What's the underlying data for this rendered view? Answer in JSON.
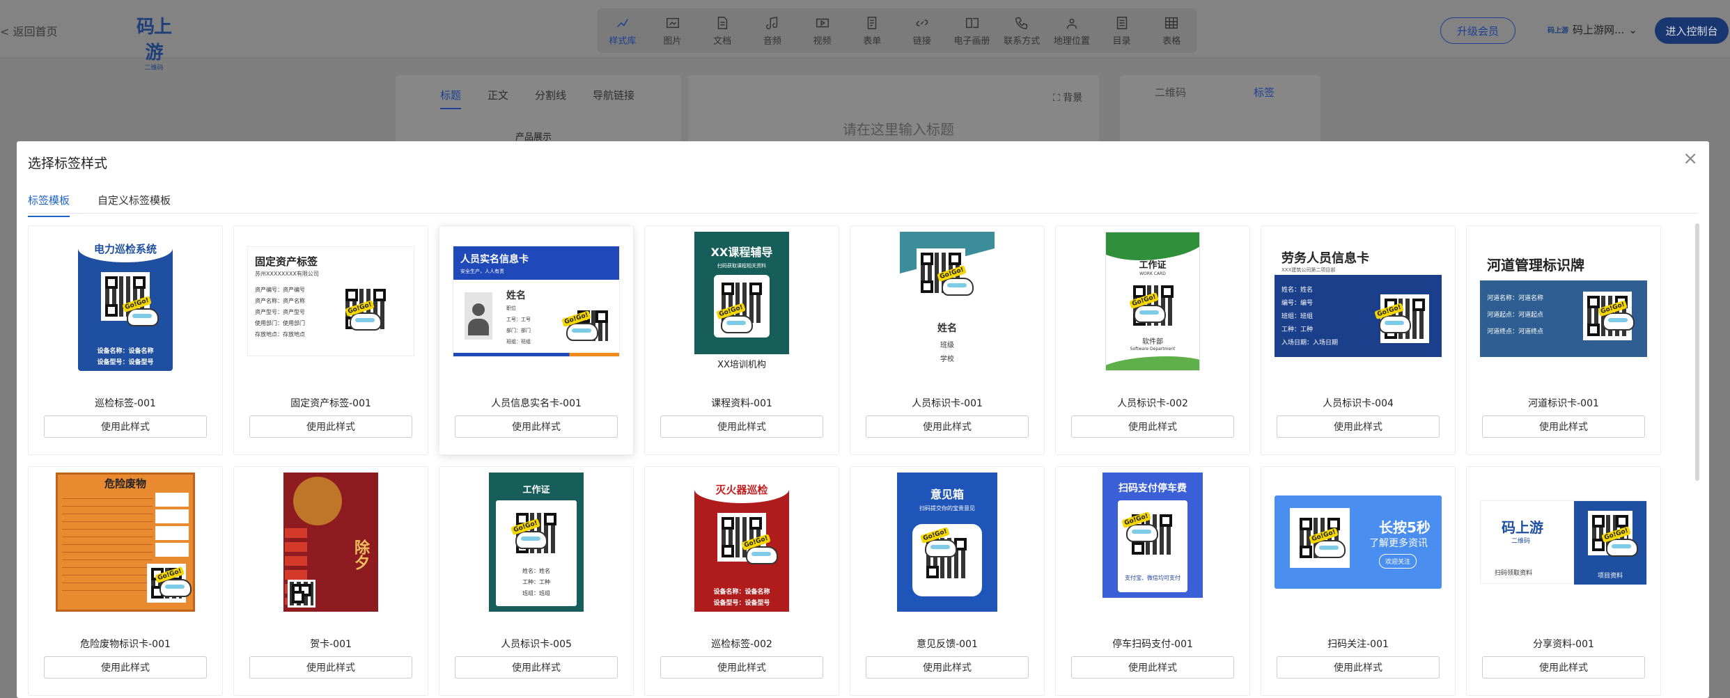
{
  "topbar": {
    "back_label": "< 返回首页",
    "logo_text": "码上游",
    "logo_sub": "二维码",
    "tools": [
      {
        "label": "样式库",
        "icon": "style-icon",
        "active": true
      },
      {
        "label": "图片",
        "icon": "image-icon"
      },
      {
        "label": "文档",
        "icon": "document-icon"
      },
      {
        "label": "音频",
        "icon": "audio-icon"
      },
      {
        "label": "视频",
        "icon": "video-icon"
      },
      {
        "label": "表单",
        "icon": "form-icon"
      },
      {
        "label": "链接",
        "icon": "link-icon"
      },
      {
        "label": "电子画册",
        "icon": "album-icon"
      },
      {
        "label": "联系方式",
        "icon": "phone-icon"
      },
      {
        "label": "地理位置",
        "icon": "location-icon"
      },
      {
        "label": "目录",
        "icon": "catalog-icon"
      },
      {
        "label": "表格",
        "icon": "table-icon"
      }
    ],
    "upgrade_label": "升级会员",
    "account_logo": "码上游",
    "account_name": "码上游网...",
    "enter_label": "进入控制台"
  },
  "background": {
    "tabs": [
      "标题",
      "正文",
      "分割线",
      "导航链接"
    ],
    "title_placeholder": "请在这里输入标题",
    "bg_label": "背景",
    "right_tabs": [
      "二维码",
      "标签"
    ],
    "product_label": "产品展示"
  },
  "modal": {
    "title": "选择标签样式",
    "close": "×",
    "tabs": [
      "标签模板",
      "自定义标签模板"
    ],
    "use_label": "使用此样式",
    "cards": [
      {
        "name": "巡检标签-001",
        "thumb": {
          "title": "电力巡检系统",
          "l1": "设备名称：设备名称",
          "l2": "设备型号：设备型号"
        }
      },
      {
        "name": "固定资产标签-001",
        "thumb": {
          "title": "固定资产标签",
          "sub": "苏州XXXXXXXX有限公司",
          "rows": [
            "资产编号：资产编号",
            "资产名称：资产名称",
            "资产型号：资产型号",
            "使用部门：使用部门",
            "存放地点：存放地点"
          ]
        }
      },
      {
        "name": "人员信息实名卡-001",
        "thumb": {
          "title": "人员实名信息卡",
          "sub": "安全生产，人人有责",
          "n": "姓名",
          "rows": [
            "职位",
            "工号：工号",
            "部门：部门",
            "班组：班组"
          ]
        }
      },
      {
        "name": "课程资料-001",
        "thumb": {
          "title": "XX课程辅导",
          "sub": "扫码获取课程相关资料",
          "foot": "XX培训机构"
        }
      },
      {
        "name": "人员标识卡-001",
        "thumb": {
          "n": "姓名",
          "l1": "班级",
          "l2": "学校"
        }
      },
      {
        "name": "人员标识卡-002",
        "thumb": {
          "title": "工作证",
          "sub": "WORK CARD",
          "l1": "软件部",
          "l2": "Software Department"
        }
      },
      {
        "name": "人员标识卡-004",
        "thumb": {
          "title": "劳务人员信息卡",
          "sub": "XXX建筑公司第二项目部",
          "rows": [
            "姓名：姓名",
            "编号：编号",
            "班组：班组",
            "工种：工种",
            "入场日期：入场日期"
          ]
        }
      },
      {
        "name": "河道标识卡-001",
        "thumb": {
          "title": "河道管理标识牌",
          "rows": [
            "河道名称：河道名称",
            "河道起点：河道起点",
            "河道终点：河道终点"
          ]
        }
      },
      {
        "name": "危险废物标识卡-001",
        "thumb": {
          "title": "危险废物"
        }
      },
      {
        "name": "贺卡-001",
        "thumb": {
          "title": "除夕"
        }
      },
      {
        "name": "人员标识卡-005",
        "thumb": {
          "title": "工作证",
          "rows": [
            "姓名：姓名",
            "工种：工种",
            "班组：班组"
          ]
        }
      },
      {
        "name": "巡检标签-002",
        "thumb": {
          "title": "灭火器巡检",
          "l1": "设备名称：设备名称",
          "l2": "设备型号：设备型号"
        }
      },
      {
        "name": "意见反馈-001",
        "thumb": {
          "title": "意见箱",
          "sub": "扫码提交你的宝贵意见"
        }
      },
      {
        "name": "停车扫码支付-001",
        "thumb": {
          "title": "扫码支付停车费",
          "foot": "支付宝、微信均可支付"
        }
      },
      {
        "name": "扫码关注-001",
        "thumb": {
          "title": "长按5秒",
          "sub": "了解更多资讯",
          "btn": "欢迎关注"
        }
      },
      {
        "name": "分享资料-001",
        "thumb": {
          "title": "码上游",
          "sub": "二维码",
          "l1": "扫码领取资料",
          "l2": "项目资料"
        }
      }
    ]
  },
  "colors": {
    "accent": "#1e62c9",
    "navy": "#1a3670",
    "overlay": "#7f7f7f"
  }
}
